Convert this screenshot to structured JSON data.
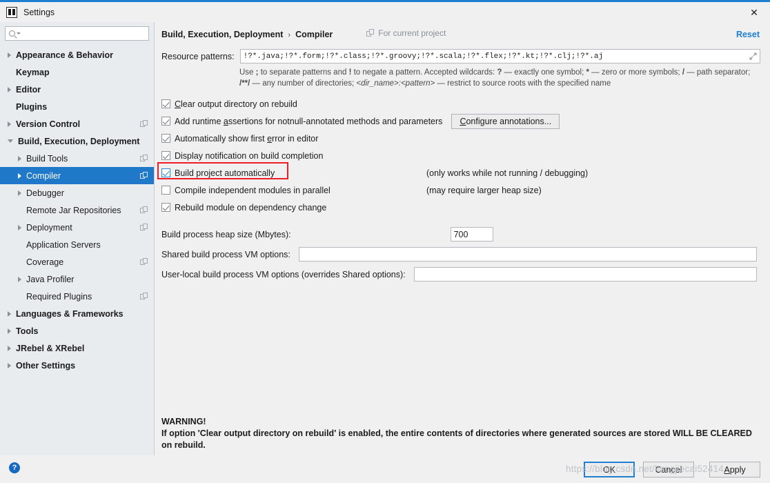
{
  "window": {
    "title": "Settings",
    "app_icon": "intellij-idea-icon",
    "close_icon": "close-icon"
  },
  "sidebar": {
    "search": {
      "placeholder": "",
      "value": "",
      "icon": "search-icon",
      "caret_icon": "chevron-down-icon"
    },
    "items": [
      {
        "label": "Appearance & Behavior",
        "level": 0,
        "arrow": "right",
        "badge": false,
        "selected": false
      },
      {
        "label": "Keymap",
        "level": 0,
        "arrow": "none",
        "badge": false,
        "selected": false
      },
      {
        "label": "Editor",
        "level": 0,
        "arrow": "right",
        "badge": false,
        "selected": false
      },
      {
        "label": "Plugins",
        "level": 0,
        "arrow": "none",
        "badge": false,
        "selected": false
      },
      {
        "label": "Version Control",
        "level": 0,
        "arrow": "right",
        "badge": true,
        "selected": false
      },
      {
        "label": "Build, Execution, Deployment",
        "level": 0,
        "arrow": "down",
        "badge": false,
        "selected": false
      },
      {
        "label": "Build Tools",
        "level": 1,
        "arrow": "right",
        "badge": true,
        "selected": false
      },
      {
        "label": "Compiler",
        "level": 1,
        "arrow": "right",
        "badge": true,
        "selected": true
      },
      {
        "label": "Debugger",
        "level": 1,
        "arrow": "right",
        "badge": false,
        "selected": false
      },
      {
        "label": "Remote Jar Repositories",
        "level": 1,
        "arrow": "none",
        "badge": true,
        "selected": false
      },
      {
        "label": "Deployment",
        "level": 1,
        "arrow": "right",
        "badge": true,
        "selected": false
      },
      {
        "label": "Application Servers",
        "level": 1,
        "arrow": "none",
        "badge": false,
        "selected": false
      },
      {
        "label": "Coverage",
        "level": 1,
        "arrow": "none",
        "badge": true,
        "selected": false
      },
      {
        "label": "Java Profiler",
        "level": 1,
        "arrow": "right",
        "badge": false,
        "selected": false
      },
      {
        "label": "Required Plugins",
        "level": 1,
        "arrow": "none",
        "badge": true,
        "selected": false
      },
      {
        "label": "Languages & Frameworks",
        "level": 0,
        "arrow": "right",
        "badge": false,
        "selected": false
      },
      {
        "label": "Tools",
        "level": 0,
        "arrow": "right",
        "badge": false,
        "selected": false
      },
      {
        "label": "JRebel & XRebel",
        "level": 0,
        "arrow": "right",
        "badge": false,
        "selected": false
      },
      {
        "label": "Other Settings",
        "level": 0,
        "arrow": "right",
        "badge": false,
        "selected": false
      }
    ]
  },
  "content": {
    "breadcrumb": {
      "parent": "Build, Execution, Deployment",
      "separator": "›",
      "current": "Compiler"
    },
    "scope_label": "For current project",
    "scope_icon": "project-scope-icon",
    "reset_label": "Reset",
    "resource_patterns": {
      "label": "Resource patterns:",
      "value": "!?*.java;!?*.form;!?*.class;!?*.groovy;!?*.scala;!?*.flex;!?*.kt;!?*.clj;!?*.aj",
      "expand_icon": "expand-icon"
    },
    "hint": {
      "p1": "Use ",
      "b1": ";",
      "p2": " to separate patterns and ",
      "b2": "!",
      "p3": " to negate a pattern. Accepted wildcards: ",
      "b3": "?",
      "p4": " — exactly one symbol; ",
      "b4": "*",
      "p5": " — zero or more symbols; ",
      "b5": "/",
      "p6": " — path separator; ",
      "b6": "/**/",
      "p7": " — any number of directories; ",
      "i1": "<dir_name>:<pattern>",
      "p8": " — restrict to source roots with the specified name"
    },
    "options": [
      {
        "label": "Clear output directory on rebuild",
        "checked": true,
        "focused": false,
        "mnemonic": "C",
        "note": "",
        "button": ""
      },
      {
        "label": "Add runtime assertions for notnull-annotated methods and parameters",
        "checked": true,
        "focused": false,
        "mnemonic": "a",
        "note": "",
        "button": "Configure annotations..."
      },
      {
        "label": "Automatically show first error in editor",
        "checked": true,
        "focused": false,
        "mnemonic": "e",
        "note": "",
        "button": ""
      },
      {
        "label": "Display notification on build completion",
        "checked": true,
        "focused": false,
        "mnemonic": "",
        "note": "",
        "button": ""
      },
      {
        "label": "Build project automatically",
        "checked": true,
        "focused": true,
        "mnemonic": "",
        "note": "(only works while not running / debugging)",
        "button": "",
        "highlighted": true
      },
      {
        "label": "Compile independent modules in parallel",
        "checked": false,
        "focused": false,
        "mnemonic": "",
        "note": "(may require larger heap size)",
        "button": ""
      },
      {
        "label": "Rebuild module on dependency change",
        "checked": true,
        "focused": false,
        "mnemonic": "",
        "note": "",
        "button": ""
      }
    ],
    "fields": [
      {
        "label": "Build process heap size (Mbytes):",
        "value": "700",
        "placeholder": "",
        "size": "small"
      },
      {
        "label": "Shared build process VM options:",
        "value": "",
        "placeholder": "",
        "size": "wide"
      },
      {
        "label": "User-local build process VM options (overrides Shared options):",
        "value": "",
        "placeholder": "",
        "size": "wide"
      }
    ],
    "warning": {
      "title": "WARNING!",
      "body": "If option 'Clear output directory on rebuild' is enabled, the entire contents of directories where generated sources are stored WILL BE CLEARED on rebuild."
    }
  },
  "footer": {
    "help_icon": "help-icon",
    "help_glyph": "?",
    "ok_label": "OK",
    "cancel_label": "Cancel",
    "apply_label": "Apply",
    "apply_mnemonic": "A"
  },
  "watermark": "https://blog.csdn.net/liangjiecai52414",
  "colors": {
    "accent": "#1f7fd0",
    "selection": "#2079c8",
    "highlight_box": "#ee1c25",
    "sidebar_bg": "#e8ecef",
    "content_bg": "#f0f0f0"
  }
}
